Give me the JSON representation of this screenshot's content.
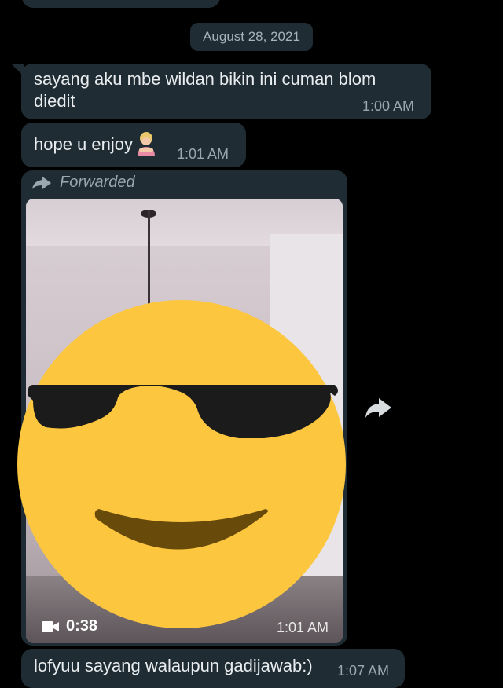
{
  "date_chip": "August 28, 2021",
  "messages": [
    {
      "text_line1": "sayang aku mbe wildan bikin ini cuman blom",
      "text_line2": "diedit",
      "time": "1:00 AM"
    },
    {
      "text": "hope u enjoy",
      "emoji": "person-bowing-emoji",
      "time": "1:01 AM"
    },
    {
      "forwarded_label": "Forwarded",
      "video_duration": "0:38",
      "time": "1:01 AM",
      "overlay": "sunglasses-emoji"
    },
    {
      "text": "lofyuu sayang walaupun gadijawab:)",
      "time": "1:07 AM"
    }
  ],
  "colors": {
    "bubble": "#1f2c34",
    "background": "#000000",
    "text": "#e9edef",
    "meta": "#9aa7ae"
  }
}
